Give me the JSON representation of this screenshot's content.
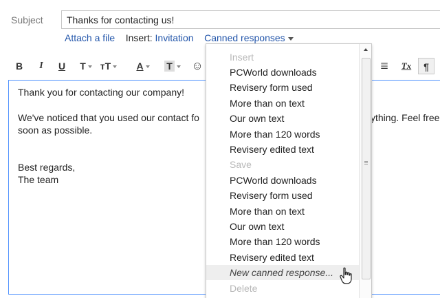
{
  "subject": {
    "label": "Subject",
    "value": "Thanks for contacting us!"
  },
  "links": {
    "attach": "Attach a file",
    "insert_label": "Insert:",
    "invitation": "Invitation",
    "canned": "Canned responses"
  },
  "toolbar": {
    "bold": "B",
    "italic": "I",
    "underline": "U",
    "font": "T",
    "size": "ᴛT",
    "text_color": "A",
    "bg_color": "T",
    "emoji": "☺",
    "align": "≣",
    "clear_format": "Tx",
    "rtl": "¶"
  },
  "editor": {
    "line1": "Thank you for contacting our company!",
    "line2_start": "We've noticed that you used our contact fo",
    "line2_end": "ything. Feel free",
    "line3": "soon as possible.",
    "line4": "Best regards,",
    "line5": "The team"
  },
  "menu": {
    "insert_header": "Insert",
    "insert_items": [
      "PCWorld downloads",
      "Revisery form used",
      "More than on text",
      "Our own text",
      "More than 120 words",
      "Revisery edited text"
    ],
    "save_header": "Save",
    "save_items": [
      "PCWorld downloads",
      "Revisery form used",
      "More than on text",
      "Our own text",
      "More than 120 words",
      "Revisery edited text"
    ],
    "new_response": "New canned response...",
    "delete_header": "Delete"
  }
}
